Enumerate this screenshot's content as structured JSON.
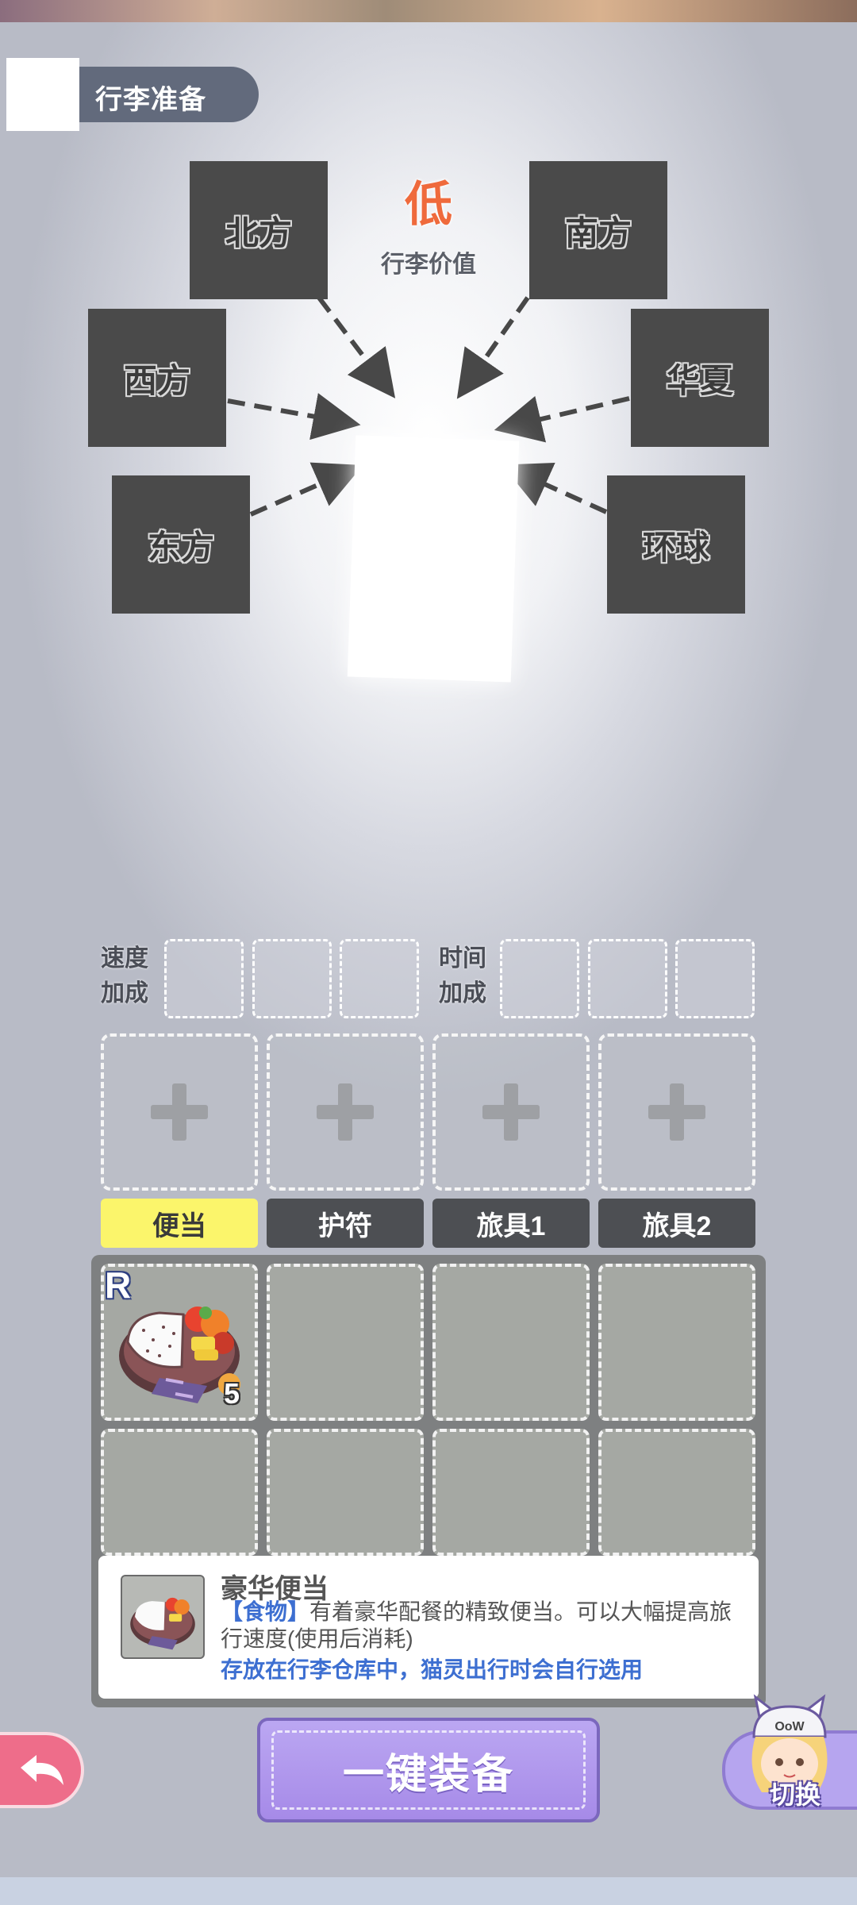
{
  "header": {
    "title": "行李准备",
    "icon": "square-placeholder-icon"
  },
  "value_indicator": {
    "level": "低",
    "label": "行李价值"
  },
  "regions": [
    {
      "id": "north",
      "label": "北方"
    },
    {
      "id": "south",
      "label": "南方"
    },
    {
      "id": "west",
      "label": "西方"
    },
    {
      "id": "huaxia",
      "label": "华夏"
    },
    {
      "id": "east",
      "label": "东方"
    },
    {
      "id": "global",
      "label": "环球"
    }
  ],
  "bonuses": {
    "speed_label_1": "速度",
    "speed_label_2": "加成",
    "time_label_1": "时间",
    "time_label_2": "加成"
  },
  "tabs": [
    {
      "label": "便当",
      "active": true
    },
    {
      "label": "护符",
      "active": false
    },
    {
      "label": "旅具1",
      "active": false
    },
    {
      "label": "旅具2",
      "active": false
    }
  ],
  "inventory": {
    "items": [
      {
        "rarity": "R",
        "count": "5",
        "icon": "bento-box-icon"
      }
    ]
  },
  "description": {
    "name": "豪华便当",
    "tag": "【食物】",
    "text": "有着豪华配餐的精致便当。可以大幅提高旅行速度(使用后消耗)",
    "note": "存放在行李仓库中，猫灵出行时会自行选用"
  },
  "buttons": {
    "equip_all": "一键装备",
    "switch": "切换",
    "back_icon": "back-arrow-icon"
  },
  "colors": {
    "active_tab": "#fbf56b",
    "accent_value": "#ef6a3c",
    "tag_blue": "#3d6fd1",
    "primary_button": "#a68ae8"
  }
}
